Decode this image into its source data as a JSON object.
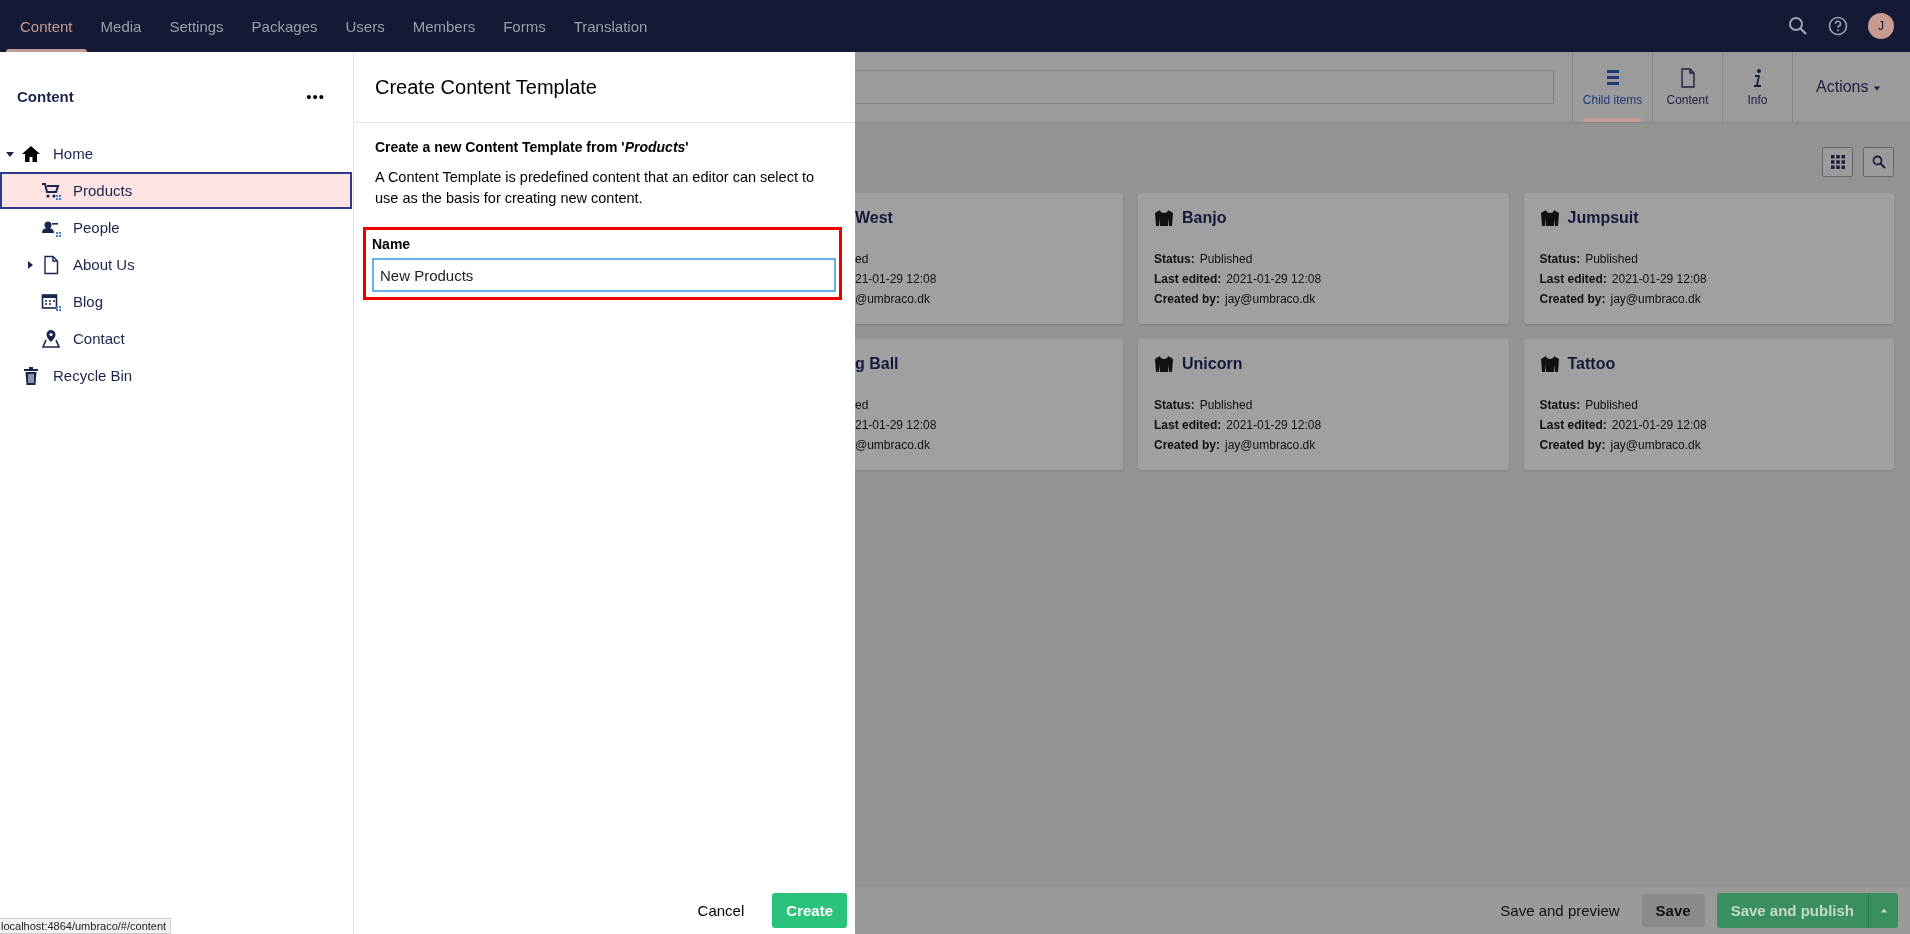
{
  "top_nav": {
    "sections": [
      {
        "label": "Content",
        "selected": true
      },
      {
        "label": "Media",
        "selected": false
      },
      {
        "label": "Settings",
        "selected": false
      },
      {
        "label": "Packages",
        "selected": false
      },
      {
        "label": "Users",
        "selected": false
      },
      {
        "label": "Members",
        "selected": false
      },
      {
        "label": "Forms",
        "selected": false
      },
      {
        "label": "Translation",
        "selected": false
      }
    ],
    "avatar": "J"
  },
  "sidebar": {
    "title": "Content",
    "menu": "•••",
    "tree": [
      {
        "label": "Home",
        "expandable": true,
        "expanded": true,
        "selected": false,
        "children": [
          {
            "label": "Products",
            "expandable": false,
            "expanded": false,
            "selected": true
          },
          {
            "label": "People",
            "expandable": false,
            "expanded": false,
            "selected": false
          },
          {
            "label": "About Us",
            "expandable": true,
            "expanded": false,
            "selected": false
          },
          {
            "label": "Blog",
            "expandable": false,
            "expanded": false,
            "selected": false
          },
          {
            "label": "Contact",
            "expandable": false,
            "expanded": false,
            "selected": false
          }
        ]
      },
      {
        "label": "Recycle Bin",
        "expandable": false,
        "expanded": false,
        "selected": false
      }
    ]
  },
  "dialog": {
    "title": "Create Content Template",
    "subtitle": "Create a new Content Template from '*Products*'",
    "description": "A Content Template is predefined content that an editor can select to use as the basis for creating new content.",
    "field": {
      "label": "Name",
      "value": "New Products",
      "highlighted": true
    },
    "buttons": [
      {
        "label": "Cancel",
        "kind": "link"
      },
      {
        "label": "Create",
        "kind": "primary"
      }
    ]
  },
  "workspace": {
    "tabs": [
      {
        "label": "Child items",
        "selected": true
      },
      {
        "label": "Content",
        "selected": false
      },
      {
        "label": "Info",
        "selected": false
      }
    ],
    "actions": "Actions",
    "cards": [
      {
        "title": "West",
        "status": "ed",
        "edited": "21-01-29 12:08",
        "created": "@umbraco.dk"
      },
      {
        "title": "Banjo",
        "status_label": "Status:",
        "status": "Published",
        "edited_label": "Last edited:",
        "edited": "2021-01-29 12:08",
        "created_label": "Created by:",
        "created": "jay@umbraco.dk"
      },
      {
        "title": "Jumpsuit",
        "status_label": "Status:",
        "status": "Published",
        "edited_label": "Last edited:",
        "edited": "2021-01-29 12:08",
        "created_label": "Created by:",
        "created": "jay@umbraco.dk"
      },
      {
        "title": "g Ball",
        "status": "ed",
        "edited": "21-01-29 12:08",
        "created": "@umbraco.dk"
      },
      {
        "title": "Unicorn",
        "status_label": "Status:",
        "status": "Published",
        "edited_label": "Last edited:",
        "edited": "2021-01-29 12:08",
        "created_label": "Created by:",
        "created": "jay@umbraco.dk"
      },
      {
        "title": "Tattoo",
        "status_label": "Status:",
        "status": "Published",
        "edited_label": "Last edited:",
        "edited": "2021-01-29 12:08",
        "created_label": "Created by:",
        "created": "jay@umbraco.dk"
      }
    ],
    "buttons": [
      {
        "label": "Save and preview",
        "kind": "link"
      },
      {
        "label": "Save",
        "kind": "secondary"
      },
      {
        "label": "Save and publish",
        "kind": "primary"
      }
    ]
  },
  "status_url": "localhost:4864/umbraco/#/content"
}
